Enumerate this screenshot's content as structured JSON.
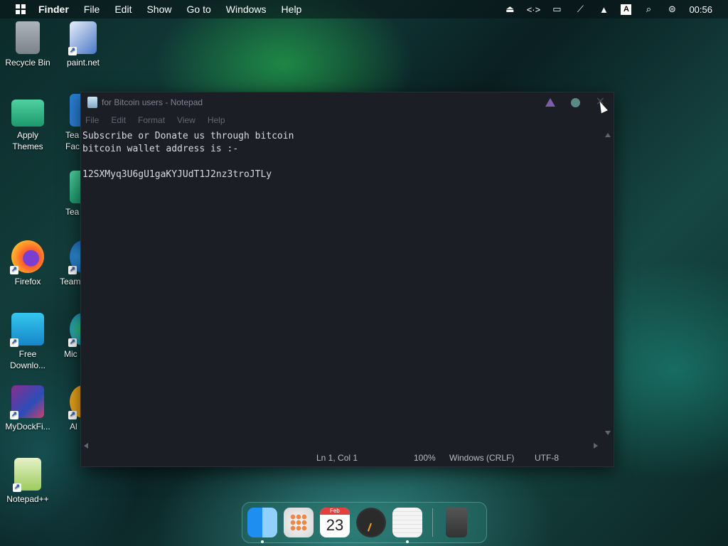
{
  "menubar": {
    "app": "Finder",
    "items": [
      "File",
      "Edit",
      "Show",
      "Go to",
      "Windows",
      "Help"
    ],
    "keyboard_indicator": "A",
    "clock": "00:56"
  },
  "desktop": {
    "icons": [
      {
        "label": "Recycle Bin"
      },
      {
        "label": "paint.net"
      },
      {
        "label": "Apply Themes"
      },
      {
        "label": "Tea Fac"
      },
      {
        "label": "Tea"
      },
      {
        "label": "Firefox"
      },
      {
        "label": "Team"
      },
      {
        "label": "Free Downlo..."
      },
      {
        "label": "Mic E"
      },
      {
        "label": "MyDockFi..."
      },
      {
        "label": "Al"
      },
      {
        "label": "Notepad++"
      }
    ]
  },
  "notepad": {
    "title": "for Bitcoin users - Notepad",
    "menu": [
      "File",
      "Edit",
      "Format",
      "View",
      "Help"
    ],
    "content": "Subscribe or Donate us through bitcoin\nbitcoin wallet address is :-\n\n12SXMyq3U6gU1gaKYJUdT1J2nz3troJTLy",
    "status": {
      "position": "Ln 1, Col 1",
      "zoom": "100%",
      "line_ending": "Windows (CRLF)",
      "encoding": "UTF-8"
    }
  },
  "dock": {
    "calendar_month": "Feb",
    "calendar_day": "23"
  }
}
